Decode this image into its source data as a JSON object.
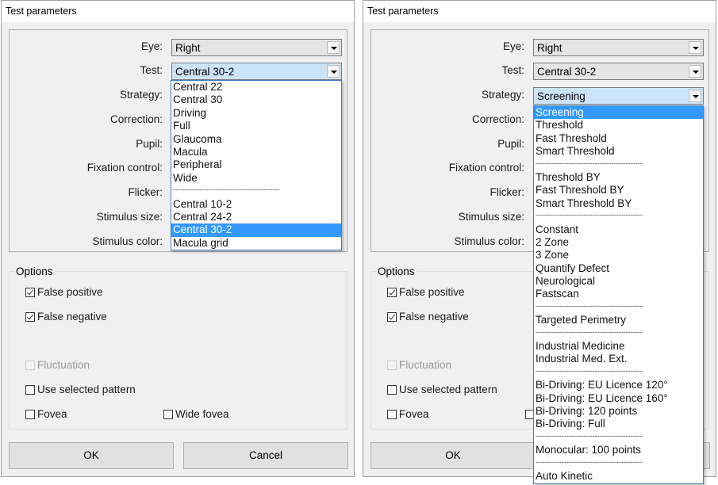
{
  "left_dialog": {
    "title": "Test parameters",
    "fields": {
      "eye": {
        "label": "Eye:",
        "value": "Right"
      },
      "test": {
        "label": "Test:",
        "value": "Central 30-2"
      },
      "strategy": {
        "label": "Strategy:"
      },
      "correction": {
        "label": "Correction:"
      },
      "pupil": {
        "label": "Pupil:"
      },
      "fixation_control": {
        "label": "Fixation control:"
      },
      "flicker": {
        "label": "Flicker:"
      },
      "stimulus_size": {
        "label": "Stimulus size:"
      },
      "stimulus_color": {
        "label": "Stimulus color:"
      }
    },
    "test_dropdown": {
      "items": [
        "Central 22",
        "Central 30",
        "Driving",
        "Full",
        "Glaucoma",
        "Macula",
        "Peripheral",
        "Wide",
        "---------------------------------------------",
        "Central 10-2",
        "Central 24-2",
        "Central 30-2",
        "Macula grid"
      ],
      "selected": "Central 30-2"
    },
    "options": {
      "title": "Options",
      "false_positive": {
        "label": "False positive",
        "checked": true
      },
      "false_negative": {
        "label": "False negative",
        "checked": true
      },
      "fluctuation": {
        "label": "Fluctuation",
        "checked": false,
        "disabled": true
      },
      "use_selected_pattern": {
        "label": "Use selected pattern",
        "checked": false
      },
      "fovea": {
        "label": "Fovea",
        "checked": false
      },
      "wide_fovea": {
        "label": "Wide fovea",
        "checked": false
      }
    },
    "ok_label": "OK",
    "cancel_label": "Cancel"
  },
  "right_dialog": {
    "title": "Test parameters",
    "fields": {
      "eye": {
        "label": "Eye:",
        "value": "Right"
      },
      "test": {
        "label": "Test:",
        "value": "Central 30-2"
      },
      "strategy": {
        "label": "Strategy:",
        "value": "Screening"
      },
      "correction": {
        "label": "Correction:"
      },
      "pupil": {
        "label": "Pupil:"
      },
      "fixation_control": {
        "label": "Fixation control:"
      },
      "flicker": {
        "label": "Flicker:"
      },
      "stimulus_size": {
        "label": "Stimulus size:"
      },
      "stimulus_color": {
        "label": "Stimulus color:"
      }
    },
    "strategy_dropdown": {
      "items": [
        "Screening",
        "Threshold",
        "Fast Threshold",
        "Smart Threshold",
        "---------------------------------------------",
        "Threshold BY",
        "Fast Threshold BY",
        "Smart Threshold BY",
        "---------------------------------------------",
        "Constant",
        "2 Zone",
        "3 Zone",
        "Quantify Defect",
        "Neurological",
        "Fastscan",
        "---------------------------------------------",
        "Targeted Perimetry",
        "---------------------------------------------",
        "Industrial Medicine",
        "Industrial Med. Ext.",
        "---------------------------------------------",
        "Bi-Driving: EU Licence 120°",
        "Bi-Driving: EU Licence 160°",
        "Bi-Driving: 120 points",
        "Bi-Driving: Full",
        "---------------------------------------------",
        "Monocular: 100 points",
        "---------------------------------------------",
        "Auto Kinetic"
      ],
      "selected": "Screening"
    },
    "options": {
      "title": "Options",
      "false_positive": {
        "label": "False positive",
        "checked": true
      },
      "false_negative": {
        "label": "False negative",
        "checked": true
      },
      "fluctuation": {
        "label": "Fluctuation",
        "checked": false,
        "disabled": true
      },
      "use_selected_pattern": {
        "label": "Use selected pattern",
        "checked": false
      },
      "fovea": {
        "label": "Fovea",
        "checked": false
      }
    },
    "ok_label": "OK"
  },
  "colors": {
    "selection": "#3399ff",
    "focused_combo": "#cce4f7",
    "dialog_bg": "#f0f0f0",
    "dropdown_border": "#3c7fc4"
  }
}
